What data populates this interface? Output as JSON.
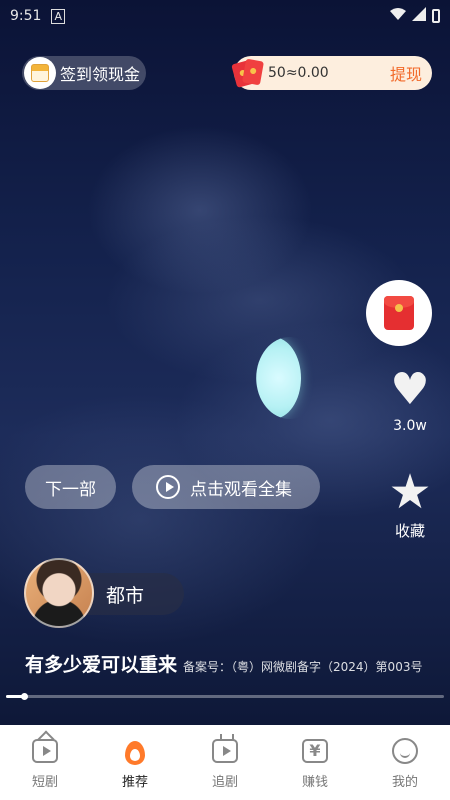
{
  "status_bar": {
    "time": "9:51",
    "notification_letter": "A"
  },
  "top": {
    "checkin_label": "签到领现金",
    "wallet_amount": "50≈0.00",
    "withdraw_label": "提现"
  },
  "right_rail": {
    "like_count": "3.0w",
    "favorite_label": "收藏"
  },
  "actions": {
    "next_label": "下一部",
    "watch_all_label": "点击观看全集"
  },
  "drama": {
    "genre": "都市",
    "title": "有多少爱可以重来",
    "license": "备案号：（粤）网微剧备字（2024）第003号",
    "progress": 0.04
  },
  "tabs": [
    {
      "label": "短剧",
      "icon": "home-play-icon"
    },
    {
      "label": "推荐",
      "icon": "flame-icon",
      "active": true
    },
    {
      "label": "追剧",
      "icon": "tv-icon"
    },
    {
      "label": "赚钱",
      "icon": "money-icon"
    },
    {
      "label": "我的",
      "icon": "smile-icon"
    }
  ],
  "colors": {
    "accent": "#f26a2a",
    "tab_active": "#ff7a2a"
  }
}
